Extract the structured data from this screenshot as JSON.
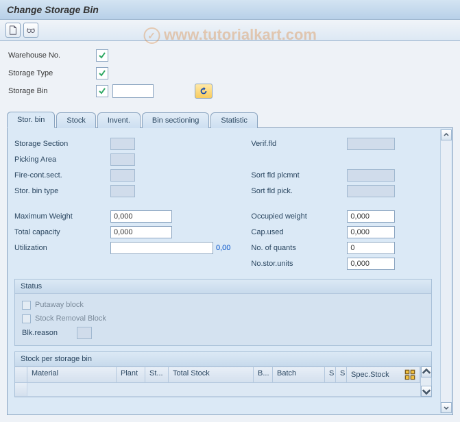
{
  "title": "Change Storage Bin",
  "watermark": "www.tutorialkart.com",
  "header": {
    "warehouse_label": "Warehouse No.",
    "storage_type_label": "Storage Type",
    "storage_bin_label": "Storage Bin",
    "storage_bin_value": ""
  },
  "tabs": [
    "Stor. bin",
    "Stock",
    "Invent.",
    "Bin sectioning",
    "Statistic"
  ],
  "left": {
    "storage_section": "Storage Section",
    "picking_area": "Picking Area",
    "fire_cont": "Fire-cont.sect.",
    "stor_bin_type": "Stor. bin type",
    "max_weight_lbl": "Maximum Weight",
    "max_weight_val": "0,000",
    "total_cap_lbl": "Total capacity",
    "total_cap_val": "0,000",
    "util_lbl": "Utilization",
    "util_val": "",
    "util_pct": "0,00"
  },
  "right": {
    "verif_lbl": "Verif.fld",
    "sort_plc_lbl": "Sort fld plcmnt",
    "sort_pick_lbl": "Sort fld pick.",
    "occ_weight_lbl": "Occupied weight",
    "occ_weight_val": "0,000",
    "cap_used_lbl": "Cap.used",
    "cap_used_val": "0,000",
    "quants_lbl": "No. of quants",
    "quants_val": "0",
    "stor_units_lbl": "No.stor.units",
    "stor_units_val": "0,000"
  },
  "status": {
    "title": "Status",
    "putaway": "Putaway block",
    "removal": "Stock Removal Block",
    "blk_reason": "Blk.reason"
  },
  "stock_table": {
    "title": "Stock per storage bin",
    "cols": [
      "Material",
      "Plant",
      "St...",
      "Total Stock",
      "B...",
      "Batch",
      "S",
      "S",
      "Spec.Stock"
    ]
  }
}
